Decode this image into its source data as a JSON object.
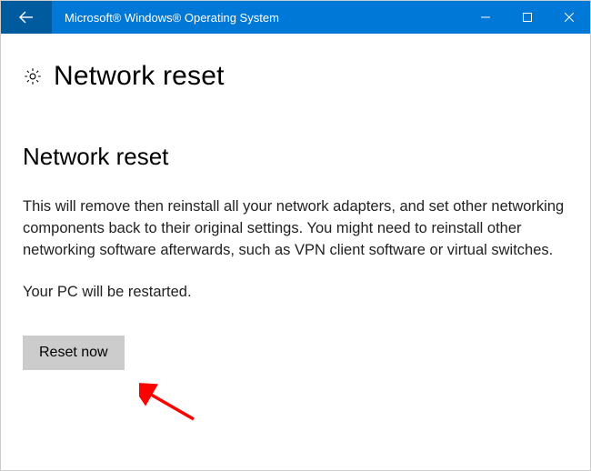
{
  "titlebar": {
    "title": "Microsoft® Windows® Operating System"
  },
  "header": {
    "title": "Network reset"
  },
  "main": {
    "subtitle": "Network reset",
    "description": "This will remove then reinstall all your network adapters, and set other networking components back to their original settings. You might need to reinstall other networking software afterwards, such as VPN client software or virtual switches.",
    "restart_note": "Your PC will be restarted.",
    "reset_button_label": "Reset now"
  },
  "colors": {
    "accent": "#0078d7",
    "accent_dark": "#005a9e",
    "button_bg": "#cccccc",
    "annotation": "#ff0000"
  }
}
